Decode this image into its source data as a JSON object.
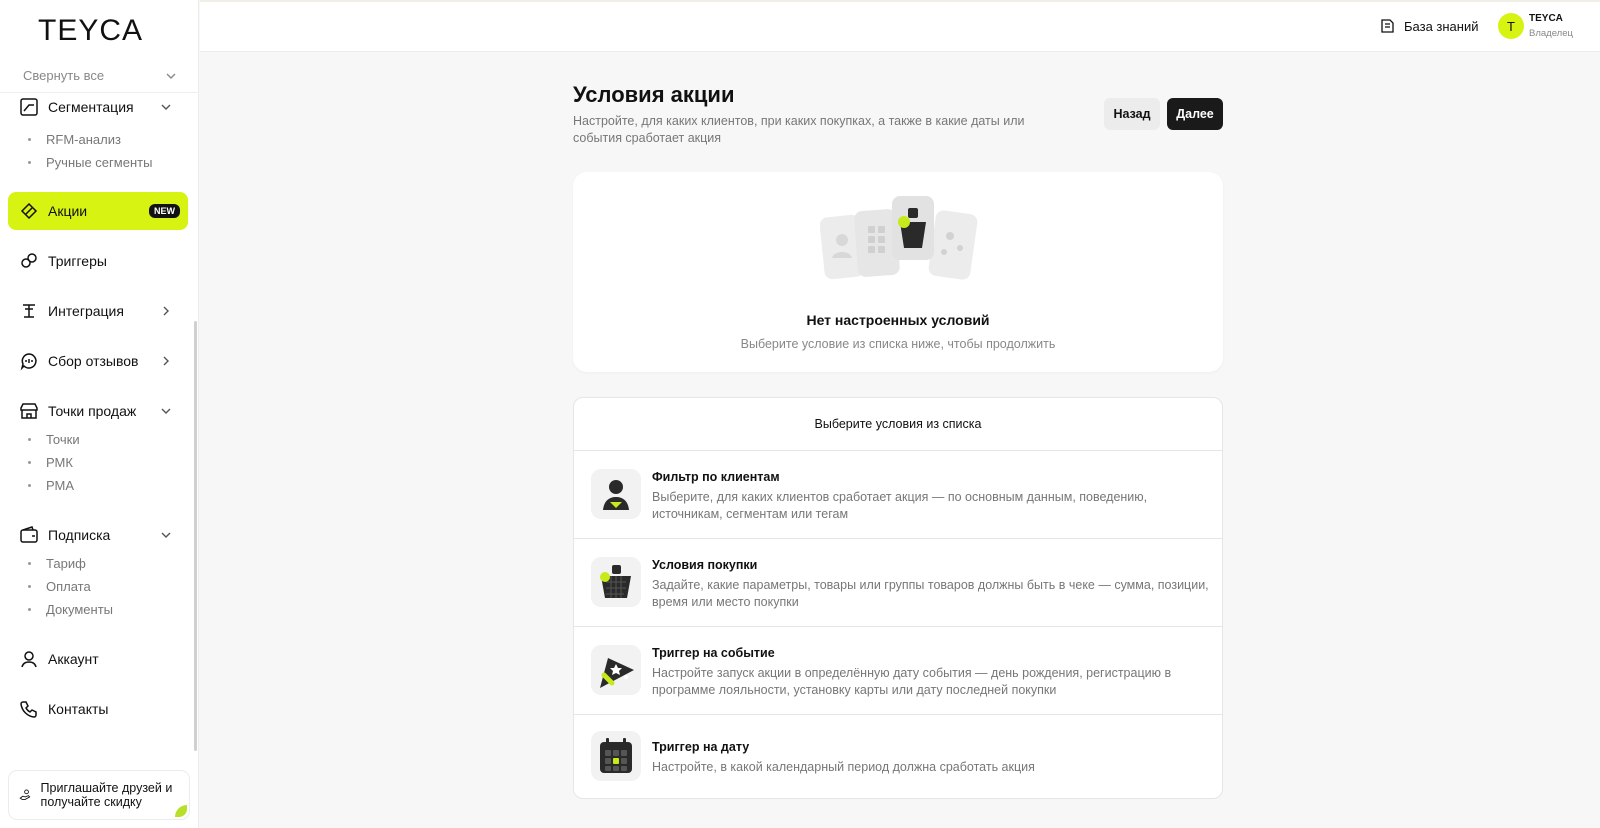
{
  "brand": {
    "logo": "TEYCA",
    "accent": "#d6f312"
  },
  "sidebar": {
    "collapse_all": "Свернуть все",
    "items": [
      {
        "label": "Сегментация",
        "icon": "segment-icon",
        "expandable": true
      },
      {
        "label": "Акции",
        "icon": "promo-icon",
        "badge": "NEW",
        "active": true
      },
      {
        "label": "Триггеры",
        "icon": "triggers-icon"
      },
      {
        "label": "Интеграция",
        "icon": "integration-icon",
        "expandable": true
      },
      {
        "label": "Сбор отзывов",
        "icon": "feedback-icon",
        "expandable": true
      },
      {
        "label": "Точки продаж",
        "icon": "store-icon",
        "expandable": true
      },
      {
        "label": "Подписка",
        "icon": "wallet-icon",
        "expandable": true
      },
      {
        "label": "Аккаунт",
        "icon": "user-icon"
      },
      {
        "label": "Контакты",
        "icon": "phone-icon"
      }
    ],
    "segment_sub": [
      "RFM-анализ",
      "Ручные сегменты"
    ],
    "stores_sub": [
      "Точки",
      "РМК",
      "РМА"
    ],
    "subscription_sub": [
      "Тариф",
      "Оплата",
      "Документы"
    ],
    "invite": "Приглашайте друзей и получайте скидку"
  },
  "header": {
    "knowledge_base": "База знаний",
    "user_initial": "T",
    "user_name": "TEYCA",
    "user_role": "Владелец"
  },
  "main": {
    "title": "Условия акции",
    "subtitle": "Настройте, для каких клиентов, при каких покупках, а также в какие даты или события сработает акция",
    "back_label": "Назад",
    "next_label": "Далее",
    "empty_title": "Нет настроенных условий",
    "empty_subtitle": "Выберите условие из списка ниже, чтобы продолжить",
    "list_header": "Выберите условия из списка",
    "conditions": [
      {
        "title": "Фильтр по клиентам",
        "desc": "Выберите, для каких клиентов сработает акция — по основным данным, поведению, источникам, сегментам или тегам",
        "icon": "client-filter-icon"
      },
      {
        "title": "Условия покупки",
        "desc": "Задайте, какие параметры, товары или группы товаров должны быть в чеке — сумма, позиции, время или место покупки",
        "icon": "basket-icon"
      },
      {
        "title": "Триггер на событие",
        "desc": "Настройте запуск акции в определённую дату события — день рождения, регистрацию в программе лояльности, установку карты или дату последней покупки",
        "icon": "party-popper-icon"
      },
      {
        "title": "Триггер на дату",
        "desc": "Настройте, в какой календарный период должна сработать акция",
        "icon": "calendar-icon"
      }
    ]
  }
}
